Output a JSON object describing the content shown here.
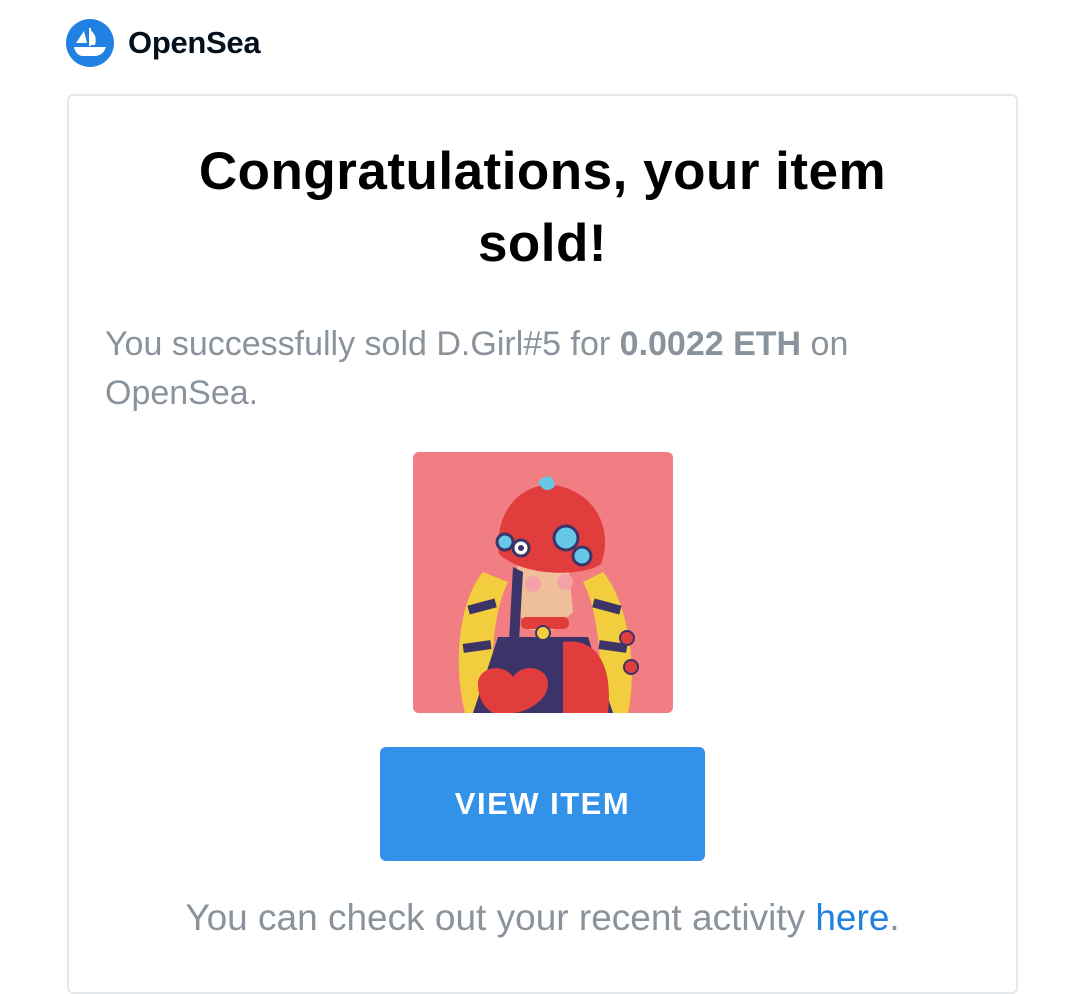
{
  "header": {
    "brand_name": "OpenSea",
    "logo_icon": "opensea-ship-icon"
  },
  "card": {
    "title": "Congratulations, your item sold!",
    "message": {
      "prefix": "You successfully sold ",
      "item_name": "D.Girl#5",
      "middle": " for ",
      "price": "0.0022 ETH",
      "suffix": " on OpenSea."
    },
    "nft_image_alt": "D.Girl#5 artwork",
    "button_label": "VIEW ITEM",
    "footer": {
      "prefix": "You can check out your recent activity ",
      "link_text": "here",
      "suffix": "."
    }
  },
  "colors": {
    "brand_blue": "#2081e2",
    "button_blue": "#3291e9",
    "muted_text": "#8a939b",
    "image_bg": "#f07e82",
    "border": "#e5e8eb"
  }
}
